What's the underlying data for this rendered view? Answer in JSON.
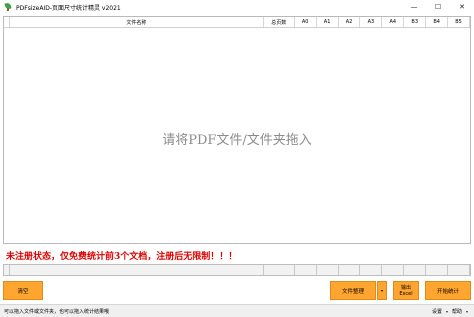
{
  "window": {
    "title": "PDFsizeAID-页面尺寸统计精灵 v2021",
    "minimize": "—",
    "maximize": "☐",
    "close": "✕"
  },
  "grid": {
    "columns": {
      "name": "文件名称",
      "total_pages": "总页数",
      "sizes": [
        "A0",
        "A1",
        "A2",
        "A3",
        "A4",
        "B3",
        "B4",
        "B5"
      ]
    },
    "drop_hint": "请将PDF文件/文件夹拖入"
  },
  "warning": "未注册状态，仅免费统计前3个文档，注册后无限制！！！",
  "buttons": {
    "clear": "清空",
    "sort": "文件整理",
    "sort_arrow": "▾",
    "export_line1": "输出",
    "export_line2": "Excel",
    "start": "开始统计"
  },
  "statusbar": {
    "text": "可以拖入文件或文件夹，也可以拖入统计结果哦",
    "settings": "设置",
    "help": "帮助",
    "dropdown_arrow": "▾"
  },
  "colors": {
    "button_orange": "#ffa530",
    "warning_red": "#e00000",
    "hint_gray": "#8c8c8c"
  }
}
